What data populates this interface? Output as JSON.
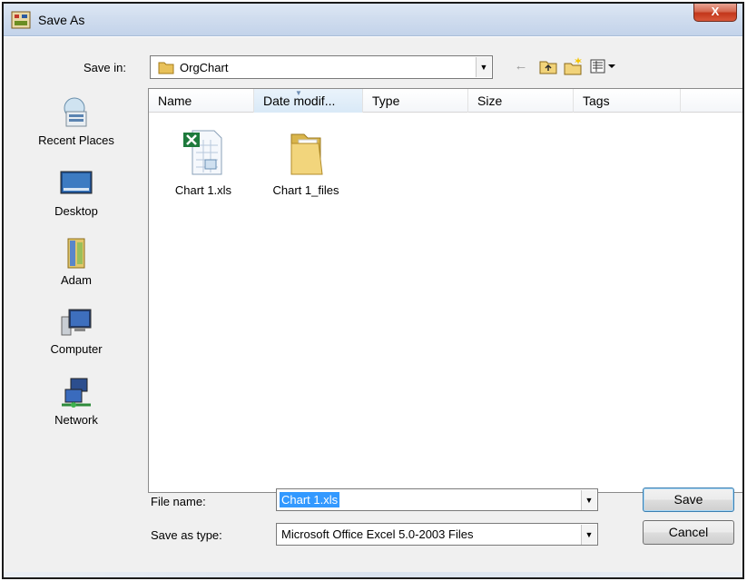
{
  "window": {
    "title": "Save As",
    "close_label": "X"
  },
  "save_in": {
    "label": "Save in:",
    "value": "OrgChart"
  },
  "toolbar": {
    "icons": [
      "back-arrow-icon",
      "up-folder-icon",
      "new-folder-icon",
      "views-menu-icon"
    ]
  },
  "places": [
    {
      "label": "Recent Places",
      "icon": "recent-places-icon"
    },
    {
      "label": "Desktop",
      "icon": "desktop-icon"
    },
    {
      "label": "Adam",
      "icon": "user-folder-icon"
    },
    {
      "label": "Computer",
      "icon": "computer-icon"
    },
    {
      "label": "Network",
      "icon": "network-icon"
    }
  ],
  "columns": [
    "Name",
    "Date modif...",
    "Type",
    "Size",
    "Tags"
  ],
  "files": [
    {
      "name": "Chart 1.xls",
      "icon": "excel-file-icon"
    },
    {
      "name": "Chart 1_files",
      "icon": "folder-icon"
    }
  ],
  "file_name": {
    "label": "File name:",
    "value": "Chart 1.xls"
  },
  "save_as_type": {
    "label": "Save as type:",
    "value": "Microsoft Office Excel 5.0-2003 Files"
  },
  "buttons": {
    "save": "Save",
    "cancel": "Cancel"
  },
  "colors": {
    "selection": "#3399ff",
    "titlebar": "#cfdcee",
    "close": "#c3361a"
  }
}
